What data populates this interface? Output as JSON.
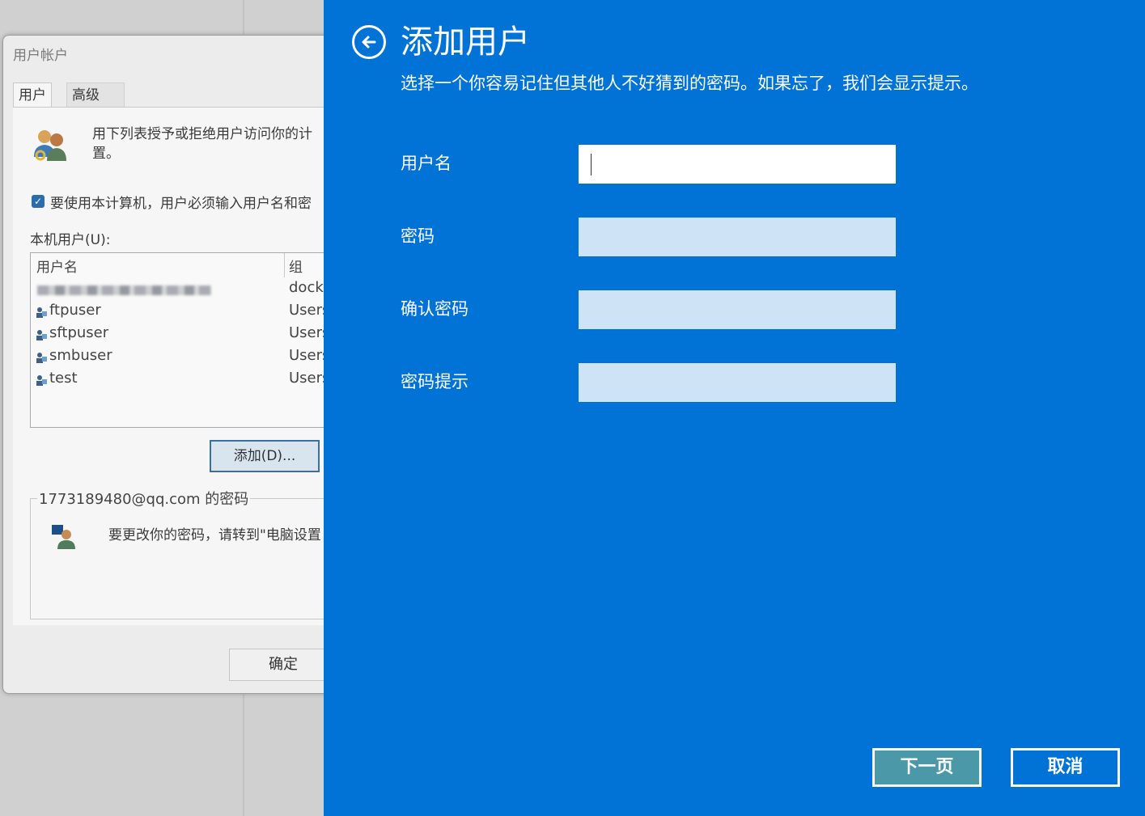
{
  "background_window": {
    "title": "用户帐户",
    "tabs": [
      {
        "label": "用户"
      },
      {
        "label": "高级"
      }
    ],
    "intro_text_line1": "用下列表授予或拒绝用户访问你的计",
    "intro_text_line2": "置。",
    "require_login_label": "要使用本计算机，用户必须输入用户名和密",
    "require_login_checked": true,
    "local_users_label": "本机用户(U):",
    "table": {
      "columns": [
        "用户名",
        "组"
      ],
      "rows": [
        {
          "name": "",
          "group": "dock",
          "blurred": true
        },
        {
          "name": "ftpuser",
          "group": "Users"
        },
        {
          "name": "sftpuser",
          "group": "Users"
        },
        {
          "name": "smbuser",
          "group": "Users"
        },
        {
          "name": "test",
          "group": "Users"
        }
      ]
    },
    "add_button_label": "添加(D)...",
    "password_group_title": "1773189480@qq.com 的密码",
    "password_change_text": "要更改你的密码，请转到\"电脑设置",
    "ok_button_label": "确定"
  },
  "add_user_panel": {
    "title": "添加用户",
    "subtitle": "选择一个你容易记住但其他人不好猜到的密码。如果忘了，我们会显示提示。",
    "fields": [
      {
        "label": "用户名",
        "value": ""
      },
      {
        "label": "密码",
        "value": ""
      },
      {
        "label": "确认密码",
        "value": ""
      },
      {
        "label": "密码提示",
        "value": ""
      }
    ],
    "next_button_label": "下一页",
    "cancel_button_label": "取消"
  },
  "colors": {
    "panel_background": "#0173d6",
    "active_input": "#ffffff",
    "inactive_input": "#cfe3f7",
    "next_button": "#4a98a8"
  }
}
